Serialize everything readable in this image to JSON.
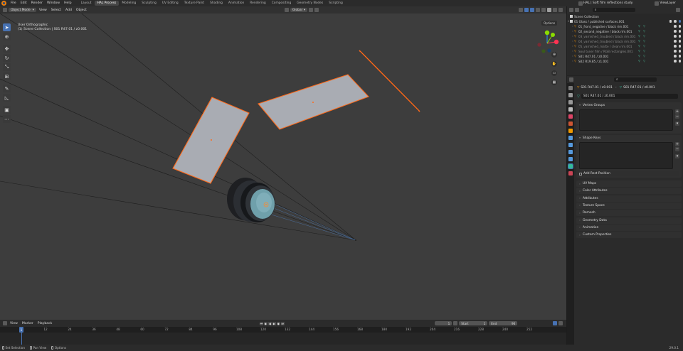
{
  "topbar": {
    "menus": [
      "File",
      "Edit",
      "Render",
      "Window",
      "Help"
    ],
    "workspaces": [
      "Layout",
      "HAL Process",
      "Modeling",
      "Sculpting",
      "UV Editing",
      "Texture Paint",
      "Shading",
      "Animation",
      "Rendering",
      "Compositing",
      "Geometry Nodes",
      "Scripting"
    ],
    "active_workspace": "HAL Process",
    "scene_name": "HAL | Soft film reflections study",
    "view_layer": "ViewLayer"
  },
  "viewport": {
    "mode": "Object Mode",
    "menus": [
      "View",
      "Select",
      "Add",
      "Object"
    ],
    "orientation": "Global",
    "options_label": "Options",
    "info_line1": "User Orthographic",
    "info_line2": "(1) Scene Collection | S01 R47.01 / z0.001",
    "axis_colors": {
      "x": "#ff3352",
      "y": "#8bdc00",
      "z": "#2890ff"
    },
    "selection_color": "#ff6a1a"
  },
  "timeline": {
    "menus": [
      "View",
      "Marker",
      "Playback"
    ],
    "current_frame": "1",
    "start_label": "Start",
    "start_value": "1",
    "end_label": "End",
    "end_value": "96",
    "ticks": [
      "1",
      "12",
      "24",
      "36",
      "48",
      "60",
      "72",
      "84",
      "96",
      "108",
      "120",
      "132",
      "144",
      "156",
      "168",
      "180",
      "192",
      "204",
      "216",
      "228",
      "240",
      "252"
    ],
    "playhead": "1"
  },
  "statusbar": {
    "items": [
      "Set Selection",
      "Pan View",
      "Options"
    ],
    "version": "29.0.1"
  },
  "outliner": {
    "root": "Scene Collection",
    "collection": "01 Glass / published surfaces.001",
    "rows": [
      {
        "label": "01_front_negative / black rim.001",
        "dim": false
      },
      {
        "label": "02_second_negative / black rim.001",
        "dim": false
      },
      {
        "label": "03_varnished_troubled / black rim.001",
        "dim": true
      },
      {
        "label": "04_varnished_troubled / black rim.001",
        "dim": true
      },
      {
        "label": "05_varnished_matte / clean rim.001",
        "dim": true
      },
      {
        "label": "Soul tuner film / RGB rectangles.001",
        "dim": true
      },
      {
        "label": "S01 R47.01 / z0.001",
        "dim": false,
        "selected": false
      },
      {
        "label": "S02 R19.85 / z1.001",
        "dim": false
      }
    ]
  },
  "properties": {
    "search_placeholder": "",
    "crumb_object": "S01 R47.01 / z0.001",
    "crumb_data": "S01 R47.01 / z0.001",
    "mesh_name": "S01 R47.01 / z0.001",
    "panel_vertex_groups": "Vertex Groups",
    "panel_shape_keys": "Shape Keys",
    "add_rest_position": "Add Rest Position",
    "collapsed_panels": [
      "UV Maps",
      "Color Attributes",
      "Attributes",
      "Texture Space",
      "Remesh",
      "Geometry Data",
      "Animation",
      "Custom Properties"
    ]
  }
}
